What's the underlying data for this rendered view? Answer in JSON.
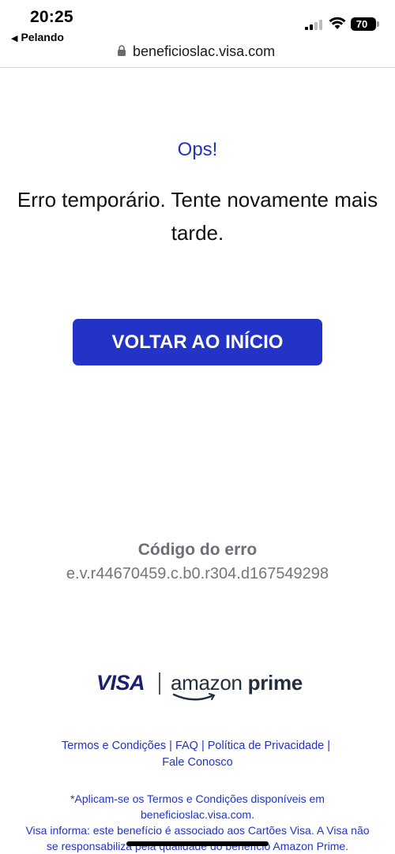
{
  "status_bar": {
    "time": "20:25",
    "back_app": "Pelando",
    "battery": "70"
  },
  "url_bar": {
    "url": "beneficioslac.visa.com"
  },
  "main": {
    "heading": "Ops!",
    "message": "Erro temporário. Tente novamente mais tarde.",
    "button_label": "VOLTAR AO INÍCIO",
    "error_code_title": "Código do erro",
    "error_code": "e.v.r44670459.c.b0.r304.d167549298"
  },
  "logos": {
    "visa": "VISA",
    "amazon_light": "amazon",
    "amazon_bold": "prime"
  },
  "footer": {
    "links": [
      "Termos e Condições",
      "FAQ",
      "Política de Privacidade",
      "Fale Conosco"
    ],
    "disclaimer_1": "*Aplicam-se os Termos e Condições disponíveis em beneficioslac.visa.com.",
    "disclaimer_2": "Visa informa: este benefício é associado aos Cartões Visa. A Visa não se responsabiliza pela qualidade do benefício Amazon Prime."
  },
  "colors": {
    "accent": "#2233c5",
    "visa_blue": "#1a1f71",
    "error_grey": "#6c6f76"
  }
}
